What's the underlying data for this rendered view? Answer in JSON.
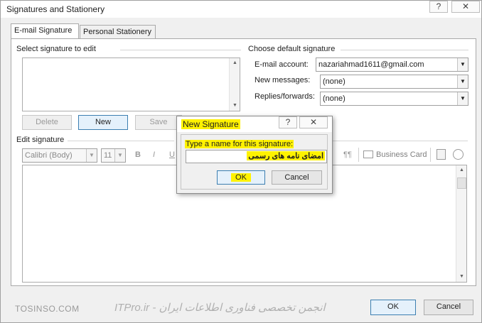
{
  "window": {
    "title": "Signatures and Stationery",
    "help_label": "?",
    "close_label": "✕"
  },
  "tabs": [
    {
      "label": "E-mail Signature"
    },
    {
      "label": "Personal Stationery"
    }
  ],
  "select_group": {
    "label": "Select signature to edit"
  },
  "buttons": {
    "delete": "Delete",
    "new": "New",
    "save": "Save"
  },
  "default_group": {
    "label": "Choose default signature",
    "email_account_label": "E-mail account:",
    "email_account_value": "nazariahmad1611@gmail.com",
    "new_messages_label": "New messages:",
    "new_messages_value": "(none)",
    "replies_label": "Replies/forwards:",
    "replies_value": "(none)"
  },
  "edit": {
    "label": "Edit signature",
    "font": "Calibri (Body)",
    "size": "11",
    "bold": "B",
    "italic": "I",
    "underline": "U",
    "pilcrow": "¶¶",
    "business_card": "Business Card"
  },
  "dialog": {
    "title": "New Signature",
    "help": "?",
    "close": "✕",
    "prompt": "Type a name for this signature:",
    "value": "امضای نامه های رسمی",
    "ok": "OK",
    "cancel": "Cancel"
  },
  "footer": {
    "watermark_left": "TOSINSO.COM",
    "watermark_mid": "ITPro.ir - انجمن تخصصی فناوری اطلاعات ایران",
    "ok": "OK",
    "cancel": "Cancel"
  },
  "colors": {
    "highlight": "#fff200",
    "accent_border": "#3c7fb1"
  }
}
